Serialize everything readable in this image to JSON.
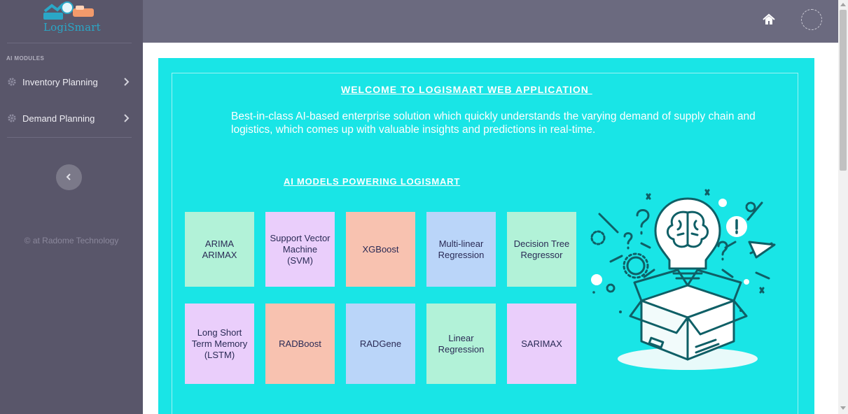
{
  "brand": {
    "name": "LogiSmart"
  },
  "sidebar": {
    "section_label": "AI MODULES",
    "items": [
      {
        "label": "Inventory Planning",
        "icon": "gear-icon"
      },
      {
        "label": "Demand Planning",
        "icon": "gear-icon"
      }
    ],
    "copyright": "© at Radome Technology"
  },
  "topbar": {
    "home_icon": "home-icon",
    "avatar_icon": "avatar"
  },
  "main": {
    "welcome_title": "WELCOME TO LOGISMART WEB APPLICATION ",
    "description": "Best-in-class AI-based enterprise solution which quickly understands the varying demand of supply chain and logistics, which comes up with valuable insights and predictions in real-time.",
    "models_title": "AI MODELS POWERING LOGISMART",
    "models": [
      {
        "label": "ARIMA ARIMAX",
        "color": "#b2f2d8"
      },
      {
        "label": "Support Vector Machine (SVM)",
        "color": "#eacefb"
      },
      {
        "label": "XGBoost",
        "color": "#f8c2b0"
      },
      {
        "label": "Multi-linear Regression",
        "color": "#bad5f9"
      },
      {
        "label": "Decision Tree Regressor",
        "color": "#b2f2d8"
      },
      {
        "label": "Long Short Term Memory (LSTM)",
        "color": "#eacefb"
      },
      {
        "label": "RADBoost",
        "color": "#f8c2b0"
      },
      {
        "label": "RADGene",
        "color": "#bad5f9"
      },
      {
        "label": "Linear Regression",
        "color": "#b2f2d8"
      },
      {
        "label": "SARIMAX",
        "color": "#eacefb"
      }
    ]
  },
  "colors": {
    "sidebar_bg": "#59566a",
    "topbar_bg": "#6b6a7f",
    "card_bg": "#19e5e6",
    "illustration_stroke": "#0f5f66"
  }
}
